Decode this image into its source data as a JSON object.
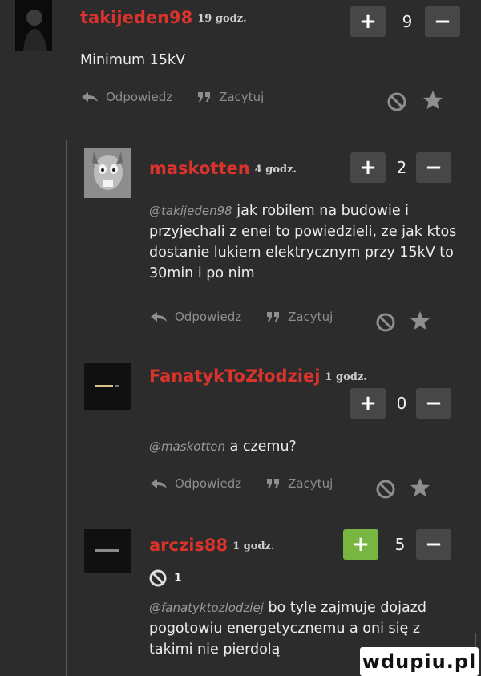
{
  "comments": [
    {
      "username": "takijeden98",
      "time": "19 godz.",
      "vote_count": "9",
      "vote_plus": "+",
      "vote_minus": "−",
      "mention": "",
      "text": "Minimum 15kV",
      "reply_label": "Odpowiedz",
      "quote_label": "Zacytuj"
    },
    {
      "username": "maskotten",
      "time": "4 godz.",
      "vote_count": "2",
      "vote_plus": "+",
      "vote_minus": "−",
      "mention": "@takijeden98",
      "text": "jak robilem na budowie i przyjechali z enei to powiedzieli, ze jak ktos dostanie lukiem elektrycznym przy 15kV to 30min i po nim",
      "reply_label": "Odpowiedz",
      "quote_label": "Zacytuj"
    },
    {
      "username": "FanatykToZłodziej",
      "time": "1 godz.",
      "vote_count": "0",
      "vote_plus": "+",
      "vote_minus": "−",
      "mention": "@maskotten",
      "text": "a czemu?",
      "reply_label": "Odpowiedz",
      "quote_label": "Zacytuj"
    },
    {
      "username": "arczis88",
      "time": "1 godz.",
      "vote_count": "5",
      "vote_plus": "+",
      "vote_minus": "−",
      "reaction_count": "1",
      "mention": "@fanatyktozlodziej",
      "text": "bo tyle zajmuje dojazd pogotowiu energetycznemu a oni się z takimi nie pierdolą"
    }
  ],
  "watermark": "wdupiu.pl",
  "colors": {
    "background": "#2c2c2c",
    "username": "#d9332c",
    "vote_button": "#474747",
    "vote_button_active": "#79b541",
    "muted": "#8e8e8e"
  },
  "icons": [
    "reply-arrow-icon",
    "quote-icon",
    "report-icon",
    "star-icon",
    "reaction-icon"
  ]
}
